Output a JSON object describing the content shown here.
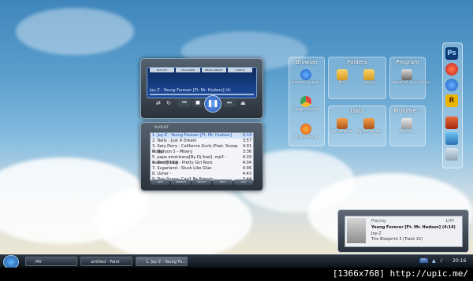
{
  "player": {
    "tabs": [
      "PLAYLIST",
      "EQUALIZER",
      "MEDIA LIBRARY",
      "CONFIG"
    ],
    "now_playing": "Jay-Z - Young Forever [Ft. Mr. Hudson] (4:",
    "playlist_title": "PLAYLIST",
    "tracks": [
      {
        "label": "1. Jay-Z - Young Forever [Ft. Mr. Hudson]",
        "time": "4:14"
      },
      {
        "label": "2. Nelly - Just A Dream",
        "time": "3:57"
      },
      {
        "label": "3. Katy Perry - California Gurls (Feat. Snoop Dogg)",
        "time": "4:01"
      },
      {
        "label": "4. Maroon 5 - Misery",
        "time": "3:36"
      },
      {
        "label": "5. papa americano[By Dj Axel] .mp3 - axelrod] 16@",
        "time": "4:29"
      },
      {
        "label": "6. Keri Hilson - Pretty Girl Rock",
        "time": "4:04"
      },
      {
        "label": "7. Sugarland - Stuck Like Glue",
        "time": "4:06"
      },
      {
        "label": "8. Usher -",
        "time": "4:43"
      },
      {
        "label": "9. Trey Songz- Can't Be Friends",
        "time": "3:44"
      }
    ],
    "buttons": [
      "ADD",
      "REMOVE",
      "SELECT",
      "MISC",
      "LIST"
    ]
  },
  "groups": {
    "browser": {
      "title": "Browser",
      "items": [
        "Internet Explorer",
        "Google chrome",
        "Mozilla Firefox"
      ]
    },
    "folders": {
      "title": "Folders",
      "items": [
        "Mnk",
        "myuuuu"
      ]
    },
    "program": {
      "title": "Program",
      "items": [
        "Wavecraft Sound Editor"
      ]
    },
    "data": {
      "title": "Data",
      "items": [
        "My Computer",
        "My Documents"
      ]
    },
    "multimedia": {
      "title": "Multime...",
      "items": [
        "Winamp"
      ]
    }
  },
  "dock": [
    "Ps"
  ],
  "notification": {
    "status": "Playing",
    "position": "1/47",
    "title": "Young Forever [Ft. Mr. Hudson] (4:14)",
    "artist": "Jay-Z",
    "album": "The Blueprint 3 (Track 15)"
  },
  "taskbar": {
    "items": [
      "MV",
      "untitled - Paint",
      "1. Jay-Z - Young Fo..."
    ],
    "lang": "EN",
    "clock": "20:16"
  },
  "caption": "[1366x768] http://upic.me/"
}
